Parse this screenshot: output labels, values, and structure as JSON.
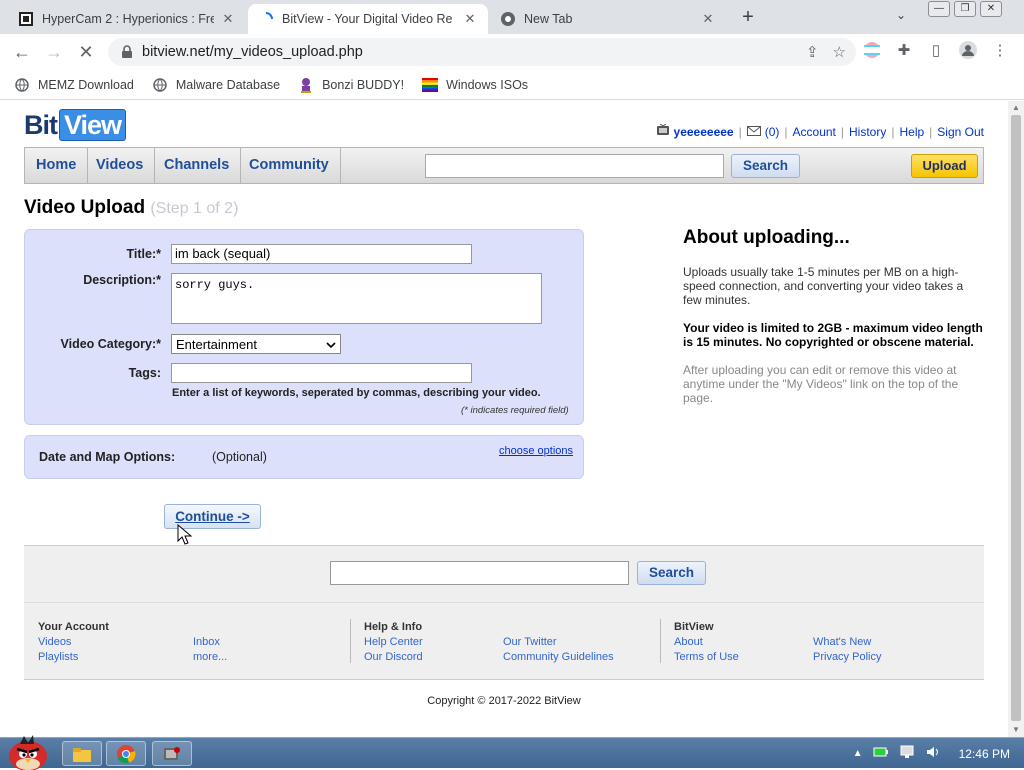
{
  "browser": {
    "tabs": [
      {
        "title": "HyperCam 2 : Hyperionics : Fre",
        "close": "✕"
      },
      {
        "title": "BitView - Your Digital Video Re",
        "close": "✕"
      },
      {
        "title": "New Tab",
        "close": "✕"
      }
    ],
    "new_tab": "+",
    "url": "bitview.net/my_videos_upload.php",
    "bookmarks": [
      {
        "label": "MEMZ Download"
      },
      {
        "label": "Malware Database"
      },
      {
        "label": "Bonzi BUDDY!"
      },
      {
        "label": "Windows ISOs"
      }
    ]
  },
  "site": {
    "logo": {
      "part1": "Bit",
      "part2": "View"
    },
    "userbar": {
      "username": "yeeeeeeee",
      "inbox_count": "(0)",
      "links": [
        "Account",
        "History",
        "Help",
        "Sign Out"
      ]
    },
    "nav": [
      "Home",
      "Videos",
      "Channels",
      "Community"
    ],
    "search_button": "Search",
    "upload_button": "Upload"
  },
  "upload": {
    "heading": "Video Upload",
    "step": "(Step 1 of 2)",
    "title_label": "Title:*",
    "title_value": "im back (sequal)",
    "description_label": "Description:*",
    "description_value": "sorry guys.",
    "category_label": "Video Category:*",
    "category_value": "Entertainment",
    "tags_label": "Tags:",
    "tags_value": "",
    "tags_hint": "Enter a list of keywords, seperated by commas, describing your video.",
    "required_note": "(* indicates required field)",
    "options_label": "Date and Map Options:",
    "options_optional": "(Optional)",
    "options_link": "choose options",
    "continue_button": "Continue ->"
  },
  "about": {
    "title": "About uploading...",
    "p1": "Uploads usually take 1-5 minutes per MB on a high-speed connection, and converting your video takes a few minutes.",
    "p2": "Your video is limited to 2GB - maximum video length is 15 minutes. No copyrighted or obscene material.",
    "p3": "After uploading you can edit or remove this video at anytime under the \"My Videos\" link on the top of the page."
  },
  "footer": {
    "search_button": "Search",
    "your_account": {
      "heading": "Your Account",
      "links": [
        "Videos",
        "Playlists",
        "Inbox",
        "more..."
      ]
    },
    "help_info": {
      "heading": "Help & Info",
      "links": [
        "Help Center",
        "Our Discord",
        "Our Twitter",
        "Community Guidelines"
      ]
    },
    "bitview": {
      "heading": "BitView",
      "links": [
        "About",
        "Terms of Use",
        "What's New",
        "Privacy Policy"
      ]
    },
    "copyright": "Copyright © 2017-2022 BitView"
  },
  "taskbar": {
    "clock": "12:46 PM"
  }
}
